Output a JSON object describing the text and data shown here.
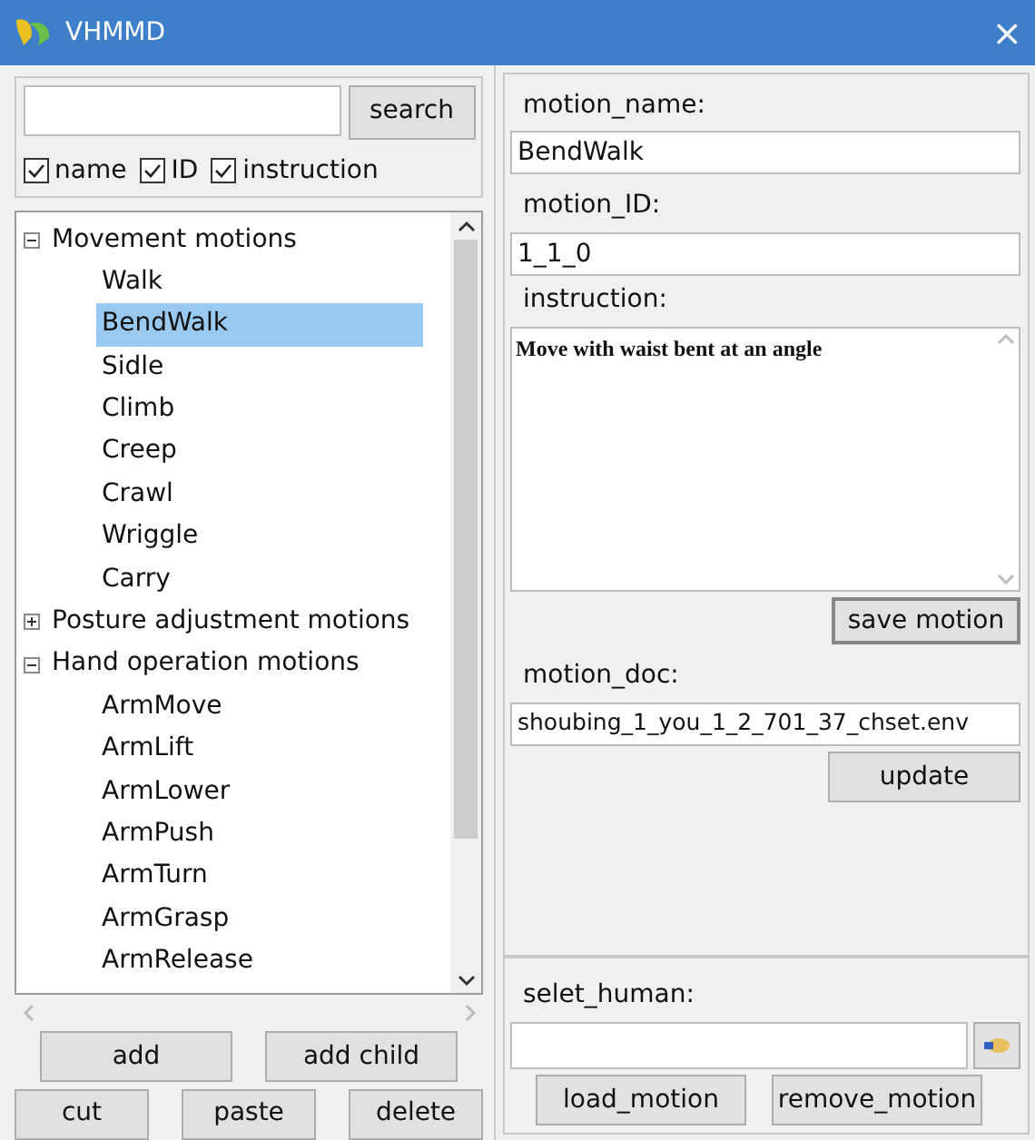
{
  "window": {
    "title": "VHMMD",
    "close": "×"
  },
  "search": {
    "button": "search"
  },
  "filters": [
    {
      "label": "name",
      "checked": true
    },
    {
      "label": "ID",
      "checked": true
    },
    {
      "label": "instruction",
      "checked": true
    }
  ],
  "tree": [
    {
      "label": "Movement motions",
      "expanded": true,
      "children": [
        {
          "label": "Walk",
          "selected": false
        },
        {
          "label": "BendWalk",
          "selected": true
        },
        {
          "label": "Sidle",
          "selected": false
        },
        {
          "label": "Climb",
          "selected": false
        },
        {
          "label": "Creep",
          "selected": false
        },
        {
          "label": "Crawl",
          "selected": false
        },
        {
          "label": "Wriggle",
          "selected": false
        },
        {
          "label": "Carry",
          "selected": false
        }
      ]
    },
    {
      "label": "Posture adjustment motions",
      "expanded": false
    },
    {
      "label": "Hand operation motions",
      "expanded": true,
      "children": [
        {
          "label": "ArmMove",
          "selected": false
        },
        {
          "label": "ArmLift",
          "selected": false
        },
        {
          "label": "ArmLower",
          "selected": false
        },
        {
          "label": "ArmPush",
          "selected": false
        },
        {
          "label": "ArmTurn",
          "selected": false
        },
        {
          "label": "ArmGrasp",
          "selected": false
        },
        {
          "label": "ArmRelease",
          "selected": false
        }
      ]
    }
  ],
  "tree_buttons": [
    [
      "add",
      "add child"
    ],
    [
      "cut",
      "paste",
      "delete"
    ]
  ],
  "fields": [
    {
      "label": "motion_name:",
      "value": "BendWalk"
    },
    {
      "label": "motion_ID:",
      "value": "1_1_0"
    }
  ],
  "instruction": {
    "label": "instruction:",
    "value": "Move with waist bent at an angle",
    "button": "save motion"
  },
  "doc": {
    "label": "motion_doc:",
    "value": "shoubing_1_you_1_2_701_37_chset.env",
    "button": "update"
  },
  "human": {
    "label": "selet_human:",
    "buttons": [
      "load_motion",
      "remove_motion"
    ]
  }
}
